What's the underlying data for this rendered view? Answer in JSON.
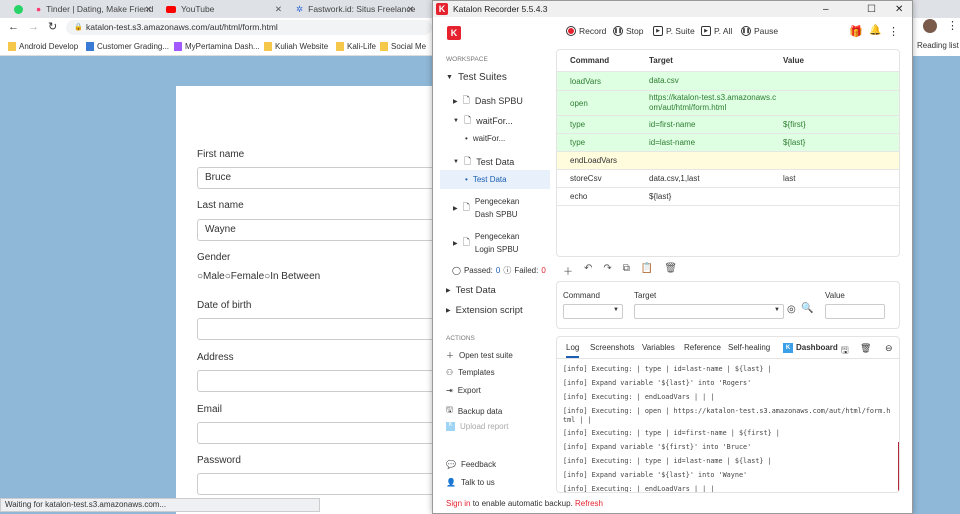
{
  "browser": {
    "tabs": [
      {
        "label": "Tinder | Dating, Make Friend"
      },
      {
        "label": "YouTube"
      },
      {
        "label": "Fastwork.id: Situs Freelance"
      }
    ],
    "url": "katalon-test.s3.amazonaws.com/aut/html/form.html",
    "bookmarks": [
      "Android Develop",
      "Customer Grading...",
      "MyPertamina Dash...",
      "Kuliah Website",
      "Kali-Life",
      "Social Me"
    ],
    "reading_list": "Reading list",
    "status": "Waiting for katalon-test.s3.amazonaws.com..."
  },
  "form": {
    "first_name_label": "First name",
    "first_name": "Bruce",
    "last_name_label": "Last name",
    "last_name": "Wayne",
    "gender_label": "Gender",
    "gender_options": [
      "Male",
      "Female",
      "In Between"
    ],
    "dob_label": "Date of birth",
    "address_label": "Address",
    "email_label": "Email",
    "password_label": "Password"
  },
  "recorder": {
    "title": "Katalon Recorder 5.5.4.3",
    "toolbar": {
      "record": "Record",
      "stop": "Stop",
      "play_suite": "P. Suite",
      "play_all": "P. All",
      "pause": "Pause"
    },
    "accent": "#e5222e",
    "sidebar": {
      "workspace": "WORKSPACE",
      "test_suites": "Test Suites",
      "items": [
        "Dash SPBU",
        "waitFor...",
        "waitFor...",
        "Test Data",
        "Test Data",
        "Pengecekan Dash SPBU",
        "Pengecekan Login SPBU"
      ],
      "passed_label": "Passed:",
      "passed": "0",
      "failed_label": "Failed:",
      "failed": "0",
      "test_data": "Test Data",
      "extension_script": "Extension script",
      "actions": "ACTIONS",
      "action_items": [
        "Open test suite",
        "Templates",
        "Export",
        "Backup data",
        "Upload report"
      ],
      "feedback": "Feedback",
      "talk": "Talk to us"
    },
    "table": {
      "headers": [
        "Command",
        "Target",
        "Value"
      ],
      "rows": [
        {
          "command": "loadVars",
          "target": "data.csv",
          "value": ""
        },
        {
          "command": "open",
          "target": "https://katalon-test.s3.amazonaws.com/aut/html/form.html",
          "value": ""
        },
        {
          "command": "type",
          "target": "id=first-name",
          "value": "${first}"
        },
        {
          "command": "type",
          "target": "id=last-name",
          "value": "${last}"
        },
        {
          "command": "endLoadVars",
          "target": "",
          "value": ""
        },
        {
          "command": "storeCsv",
          "target": "data.csv,1,last",
          "value": "last"
        },
        {
          "command": "echo",
          "target": "${last}",
          "value": ""
        }
      ]
    },
    "editor": {
      "command_label": "Command",
      "target_label": "Target",
      "value_label": "Value"
    },
    "log_tabs": [
      "Log",
      "Screenshots",
      "Variables",
      "Reference",
      "Self-healing",
      "Dashboard"
    ],
    "log": [
      "[info] Executing: | type | id=last-name | ${last} |",
      "[info] Expand variable '${last}' into 'Rogers'",
      "[info] Executing: | endLoadVars | | |",
      "[info] Executing: | open | https://katalon-test.s3.amazonaws.com/aut/html/form.html | |",
      "[info] Executing: | type | id=first-name | ${first} |",
      "[info] Expand variable '${first}' into 'Bruce'",
      "[info] Executing: | type | id=last-name | ${last} |",
      "[info] Expand variable '${last}' into 'Wayne'",
      "[info] Executing: | endLoadVars | | |"
    ],
    "footer": {
      "sign_in": "Sign in",
      "text": " to enable automatic backup. ",
      "refresh": "Refresh"
    }
  }
}
